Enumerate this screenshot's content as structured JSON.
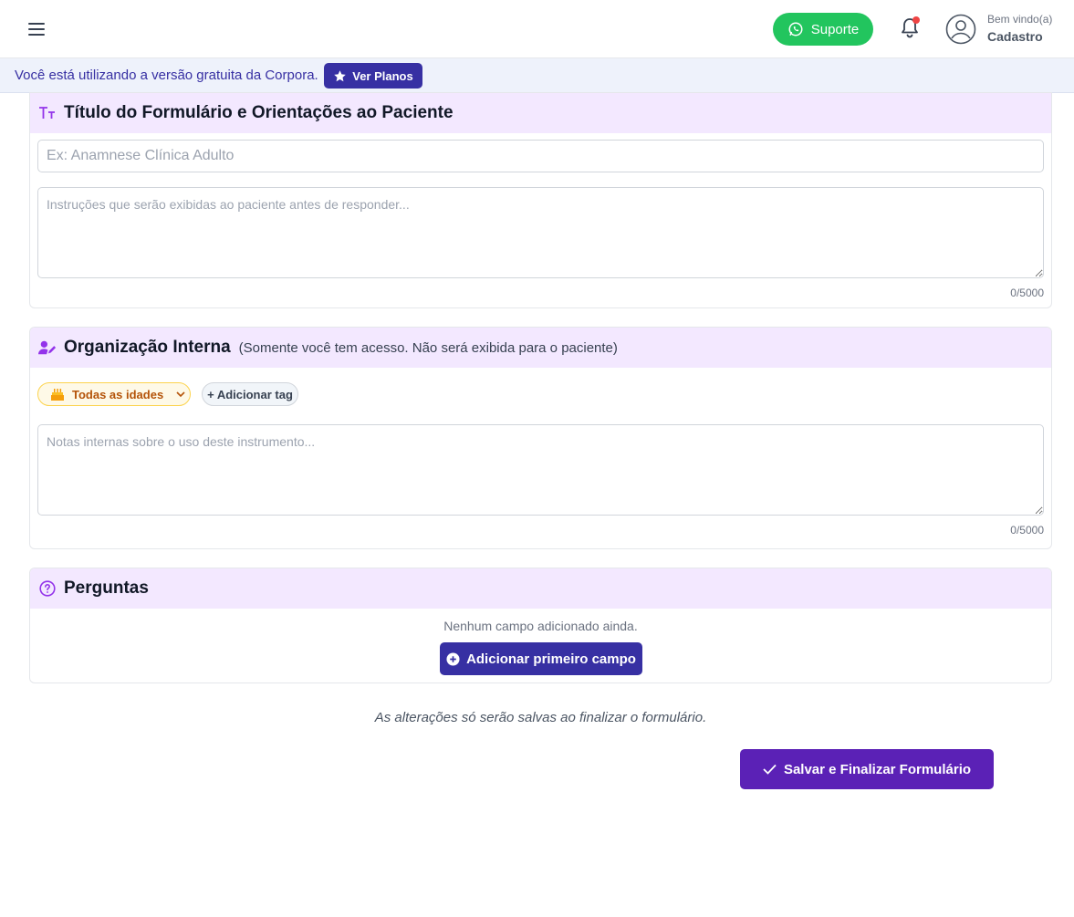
{
  "header": {
    "support_label": "Suporte",
    "welcome_text": "Bem vindo(a)",
    "user_name": "Cadastro"
  },
  "plan_banner": {
    "text": "Você está utilizando a versão gratuita da Corpora.",
    "button_label": "Ver Planos"
  },
  "title_section": {
    "heading": "Título do Formulário e Orientações ao Paciente",
    "title_placeholder": "Ex: Anamnese Clínica Adulto",
    "instructions_placeholder": "Instruções que serão exibidas ao paciente antes de responder...",
    "counter": "0/5000"
  },
  "internal_section": {
    "heading": "Organização Interna",
    "subheading": "(Somente você tem acesso. Não será exibida para o paciente)",
    "age_tag_label": "Todas as idades",
    "add_tag_label": "+ Adicionar tag",
    "notes_placeholder": "Notas internas sobre o uso deste instrumento...",
    "counter": "0/5000"
  },
  "questions_section": {
    "heading": "Perguntas",
    "empty_text": "Nenhum campo adicionado ainda.",
    "add_first_label": "Adicionar primeiro campo"
  },
  "footer": {
    "save_note": "As alterações só serão salvas ao finalizar o formulário.",
    "save_button_label": "Salvar e Finalizar Formulário"
  },
  "colors": {
    "primary": "#3730a3",
    "save": "#5b21b6",
    "section_header": "#f3e8ff",
    "support": "#22c55e",
    "notification_dot": "#ef4444"
  }
}
